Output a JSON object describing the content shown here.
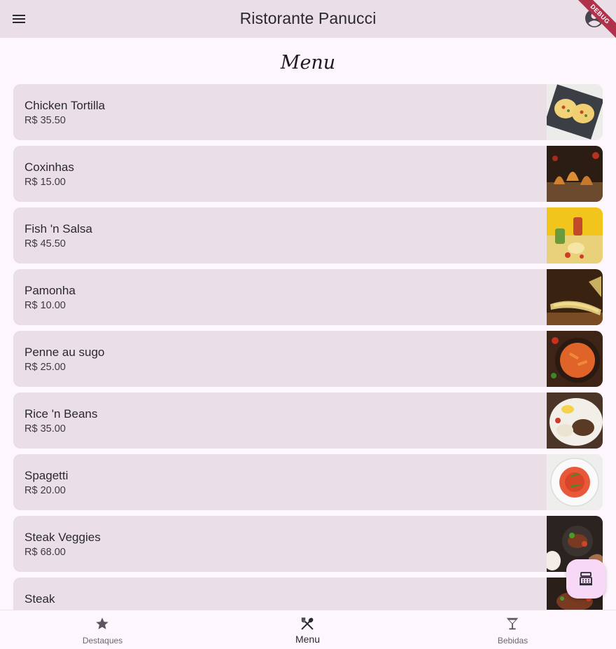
{
  "appbar": {
    "title": "Ristorante Panucci",
    "debug_label": "DEBUG"
  },
  "section": {
    "title": "Menu"
  },
  "menu_items": [
    {
      "name": "Chicken Tortilla",
      "price": "R$ 35.50"
    },
    {
      "name": "Coxinhas",
      "price": "R$ 15.00"
    },
    {
      "name": "Fish 'n Salsa",
      "price": "R$ 45.50"
    },
    {
      "name": "Pamonha",
      "price": "R$ 10.00"
    },
    {
      "name": "Penne au sugo",
      "price": "R$ 25.00"
    },
    {
      "name": "Rice 'n Beans",
      "price": "R$ 35.00"
    },
    {
      "name": "Spagetti",
      "price": "R$ 20.00"
    },
    {
      "name": "Steak Veggies",
      "price": "R$ 68.00"
    },
    {
      "name": "Steak",
      "price": ""
    }
  ],
  "bottom_nav": {
    "items": [
      {
        "label": "Destaques",
        "icon": "star-icon"
      },
      {
        "label": "Menu",
        "icon": "restaurant-icon",
        "active": true
      },
      {
        "label": "Bebidas",
        "icon": "cocktail-icon"
      }
    ]
  },
  "colors": {
    "appbar": "#ebdfe7",
    "card": "#ebdfe7",
    "background": "#fdf7fd",
    "fab": "#f7d8f6",
    "debug_banner": "#b0324a"
  }
}
